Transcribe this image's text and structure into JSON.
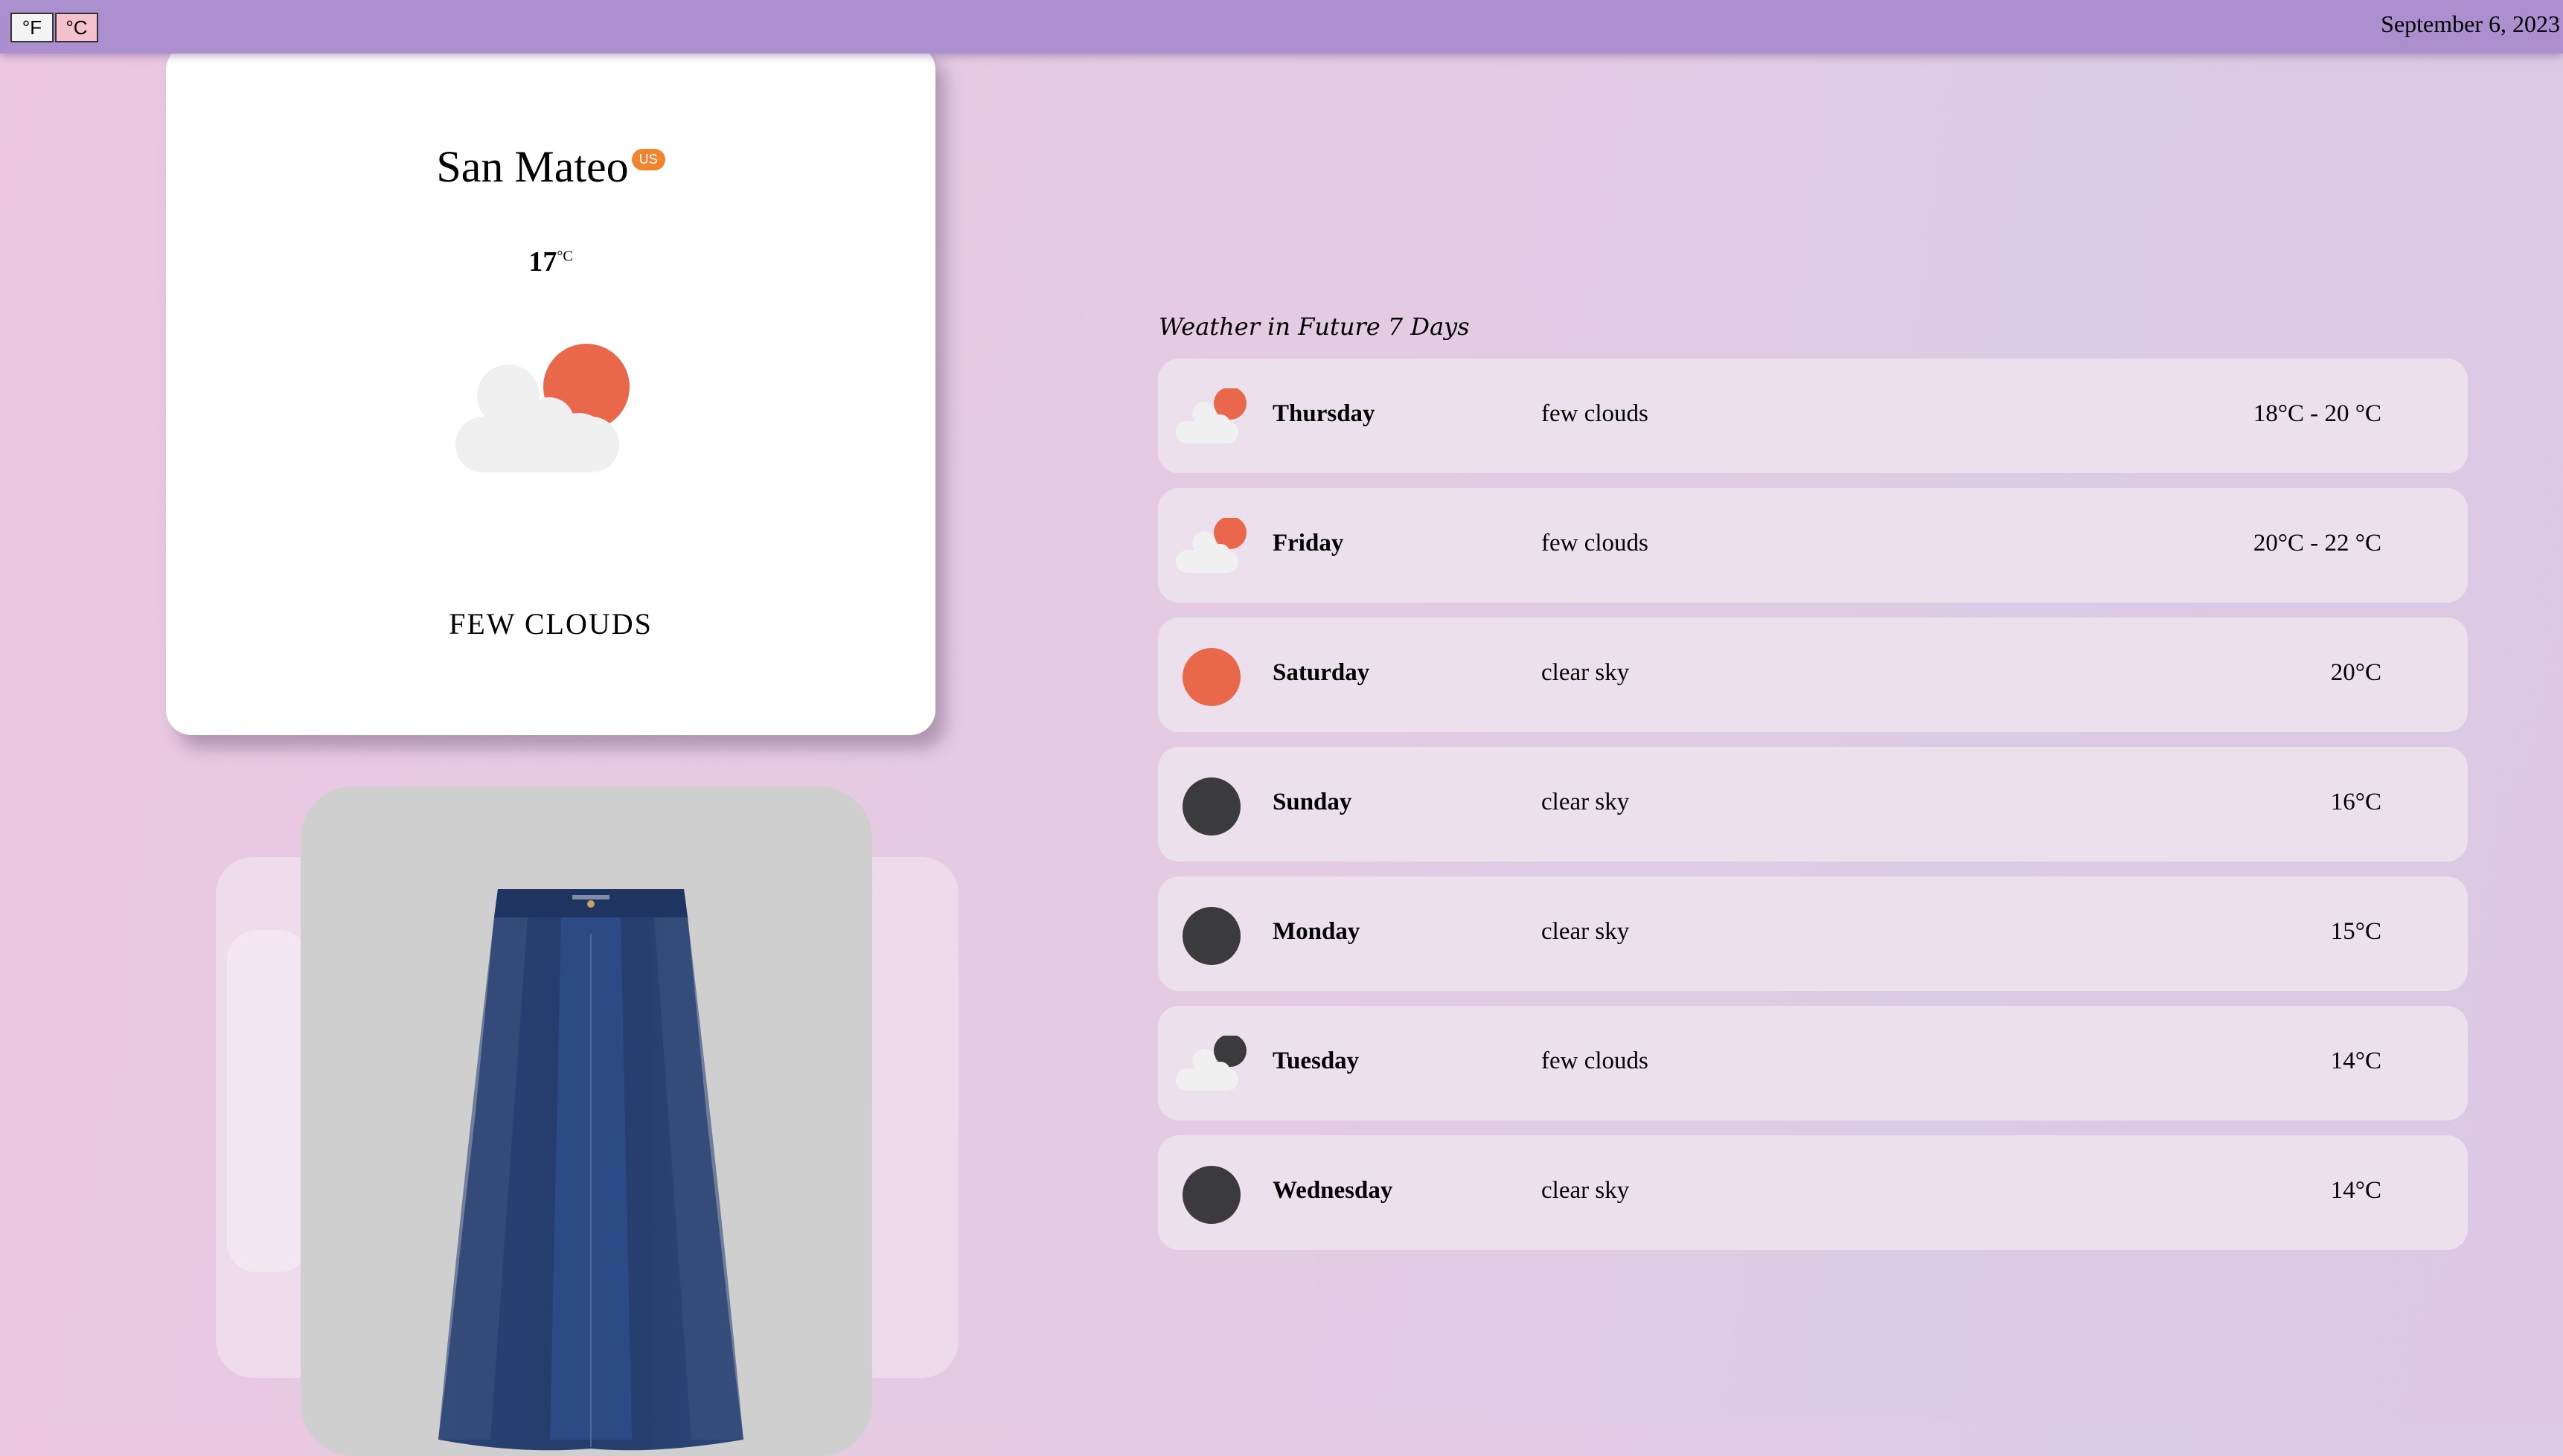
{
  "topbar": {
    "unit_fahrenheit": "°F",
    "unit_celsius": "°C",
    "date": "September 6, 2023"
  },
  "current": {
    "city": "San Mateo",
    "country": "US",
    "temperature": "17",
    "temp_unit": "°C",
    "condition": "FEW CLOUDS",
    "icon": "few-clouds-day-icon"
  },
  "forecast": {
    "title": "Weather in Future 7 Days",
    "days": [
      {
        "day": "Thursday",
        "desc": "few clouds",
        "temp": "18°C - 20 °C",
        "icon": "few-clouds-day-icon"
      },
      {
        "day": "Friday",
        "desc": "few clouds",
        "temp": "20°C - 22 °C",
        "icon": "few-clouds-day-icon"
      },
      {
        "day": "Saturday",
        "desc": "clear sky",
        "temp": "20°C",
        "icon": "clear-day-icon"
      },
      {
        "day": "Sunday",
        "desc": "clear sky",
        "temp": "16°C",
        "icon": "clear-night-icon"
      },
      {
        "day": "Monday",
        "desc": "clear sky",
        "temp": "15°C",
        "icon": "clear-night-icon"
      },
      {
        "day": "Tuesday",
        "desc": "few clouds",
        "temp": "14°C",
        "icon": "few-clouds-night-icon"
      },
      {
        "day": "Wednesday",
        "desc": "clear sky",
        "temp": "14°C",
        "icon": "clear-night-icon"
      }
    ]
  },
  "outfit": {
    "current_item": "denim-skirt-image",
    "previous_item": "shirt-image"
  },
  "colors": {
    "topbar": "#ac8fce",
    "sun": "#e9684b",
    "moon": "#3b3b3d",
    "cloud": "#f0f0f0",
    "badge": "#f08530"
  }
}
